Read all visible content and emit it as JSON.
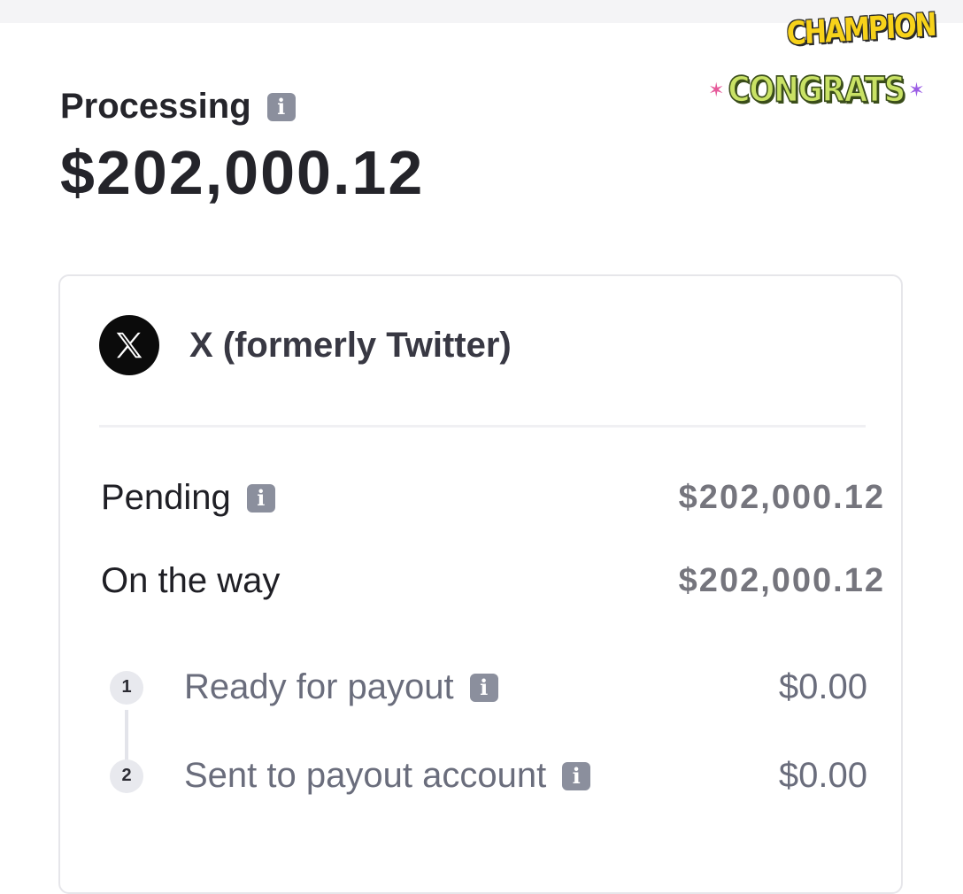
{
  "stickers": {
    "champion": "CHAMPION",
    "congrats": "CONGRATS"
  },
  "header": {
    "label": "Processing",
    "amount": "$202,000.12"
  },
  "card": {
    "company": "X (formerly Twitter)",
    "rows": [
      {
        "label": "Pending",
        "value": "$202,000.12",
        "has_info": true
      },
      {
        "label": "On the way",
        "value": "$202,000.12",
        "has_info": false
      }
    ],
    "steps": [
      {
        "num": "1",
        "label": "Ready for payout",
        "value": "$0.00"
      },
      {
        "num": "2",
        "label": "Sent to payout account",
        "value": "$0.00"
      }
    ]
  },
  "icons": {
    "info": "info-icon",
    "brand": "x-logo-icon"
  },
  "colors": {
    "info_icon": "#8b8f9d",
    "amount_text": "#24242a",
    "muted_value": "#75757d",
    "step_text": "#6a6d7c",
    "brand_logo": "#0b0b0b"
  }
}
